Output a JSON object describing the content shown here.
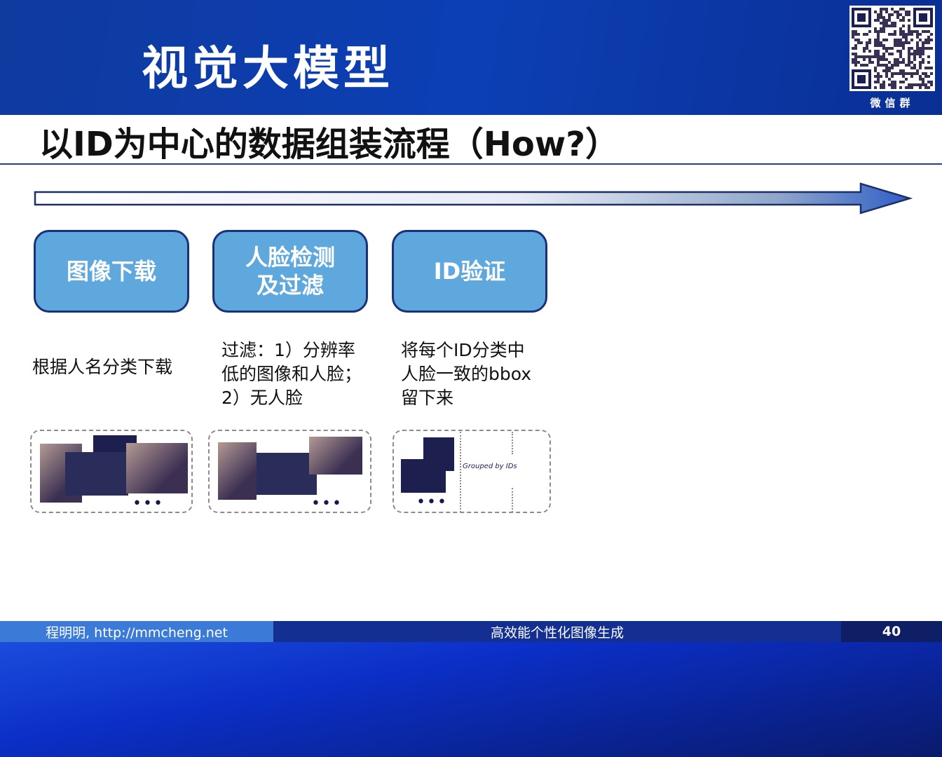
{
  "header": {
    "title": "视觉大模型",
    "qr_label": "微信群"
  },
  "subtitle": "以ID为中心的数据组装流程（How?）",
  "steps": [
    {
      "label": "图像下载",
      "desc": "根据人名分类下载"
    },
    {
      "label": "人脸检测\n及过滤",
      "desc": "过滤：1）分辨率\n低的图像和人脸；\n2）无人脸"
    },
    {
      "label": "ID验证",
      "desc": "将每个ID分类中\n人脸一致的bbox\n留下来"
    }
  ],
  "panels": {
    "ellipsis": "•••",
    "grouped_label": "Grouped by IDs"
  },
  "footer": {
    "author": "程明明, http://mmcheng.net",
    "talk_title": "高效能个性化图像生成",
    "page_number": "40"
  },
  "colors": {
    "step_fill": "#5ea8de",
    "step_border": "#1a3178",
    "header_bg": "#0c3fb5"
  }
}
